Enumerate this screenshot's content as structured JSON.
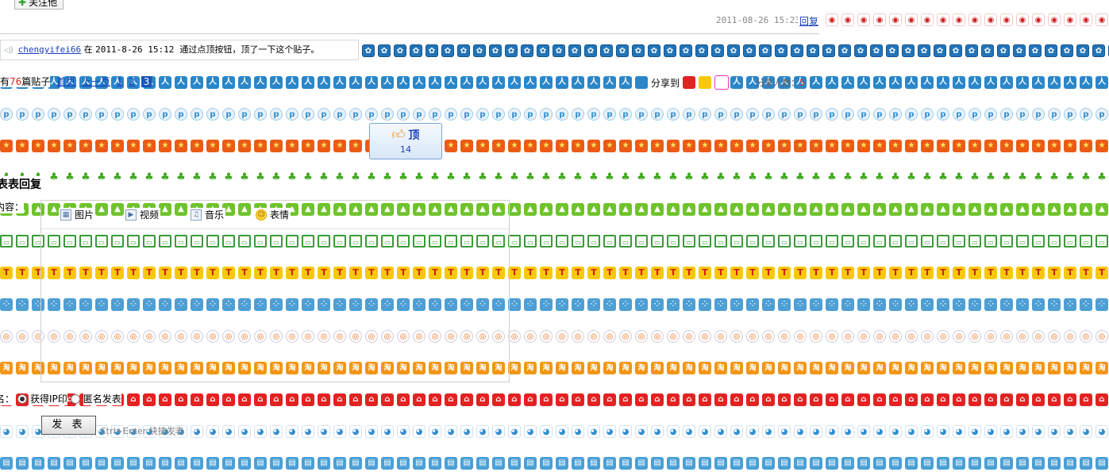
{
  "header": {
    "follow_label": "关注他",
    "timestamp": "2011-08-26 15:23",
    "reply_label": "回复"
  },
  "notice": {
    "username": "chengyifei66",
    "word_at": "在",
    "datetime": "2011-8-26 15:12",
    "message": "通过点顶按钮，顶了一下这个贴子。"
  },
  "pager": {
    "prefix": "有",
    "count": "76",
    "suffix": "篇贴子",
    "first": "首页",
    "prev": "上一页",
    "pages": [
      "1",
      "2"
    ],
    "current": "3"
  },
  "share": {
    "label": "分享到",
    "count_label": "分享人数：",
    "count": "5"
  },
  "ding": {
    "label": "顶",
    "count": "14",
    "icon": "thumbs-up-icon"
  },
  "reply_form": {
    "title": "表表回复",
    "content_label": "内容：",
    "toolbar": [
      {
        "label": "图片",
        "icon": "image-icon"
      },
      {
        "label": "视频",
        "icon": "video-icon"
      },
      {
        "label": "音乐",
        "icon": "music-icon"
      },
      {
        "label": "表情",
        "icon": "smiley-icon"
      }
    ],
    "name_label": "名：",
    "option_public": "获得IP印",
    "option_anon": "匿名发表",
    "submit_label": "发 表",
    "shortcut_hint": "Ctrl+Enter 快捷发表"
  },
  "background_rows": [
    {
      "cls": "r-weibo",
      "glyph": "◉",
      "icon": "weibo-icon"
    },
    {
      "cls": "r-paw",
      "glyph": "✿",
      "icon": "paw-icon"
    },
    {
      "cls": "r-ren",
      "glyph": "人",
      "icon": "renren-icon"
    },
    {
      "cls": "r-p",
      "glyph": "p",
      "icon": "p-circle-icon"
    },
    {
      "cls": "r-star",
      "glyph": "★",
      "icon": "star-icon"
    },
    {
      "cls": "r-clover",
      "glyph": "♣",
      "icon": "clover-icon"
    },
    {
      "cls": "r-green",
      "glyph": "▲",
      "icon": "green-mountain-icon"
    },
    {
      "cls": "r-tray",
      "glyph": "▭",
      "icon": "tray-icon"
    },
    {
      "cls": "r-t",
      "glyph": "T",
      "icon": "t-icon"
    },
    {
      "cls": "r-dots",
      "glyph": "⁘",
      "icon": "dots-icon"
    },
    {
      "cls": "r-circ",
      "glyph": "◎",
      "icon": "target-circle-icon"
    },
    {
      "cls": "r-tao",
      "glyph": "淘",
      "icon": "taobao-icon"
    },
    {
      "cls": "r-red",
      "glyph": "⌂",
      "icon": "red-house-icon"
    },
    {
      "cls": "r-bubble",
      "glyph": "◕",
      "icon": "bubble-icon"
    },
    {
      "cls": "r-box",
      "glyph": "▤",
      "icon": "box-icon"
    }
  ],
  "colors": {
    "link": "#1a3fb8",
    "count_red": "#d6281e",
    "current_page_bg": "#1a55b8"
  }
}
